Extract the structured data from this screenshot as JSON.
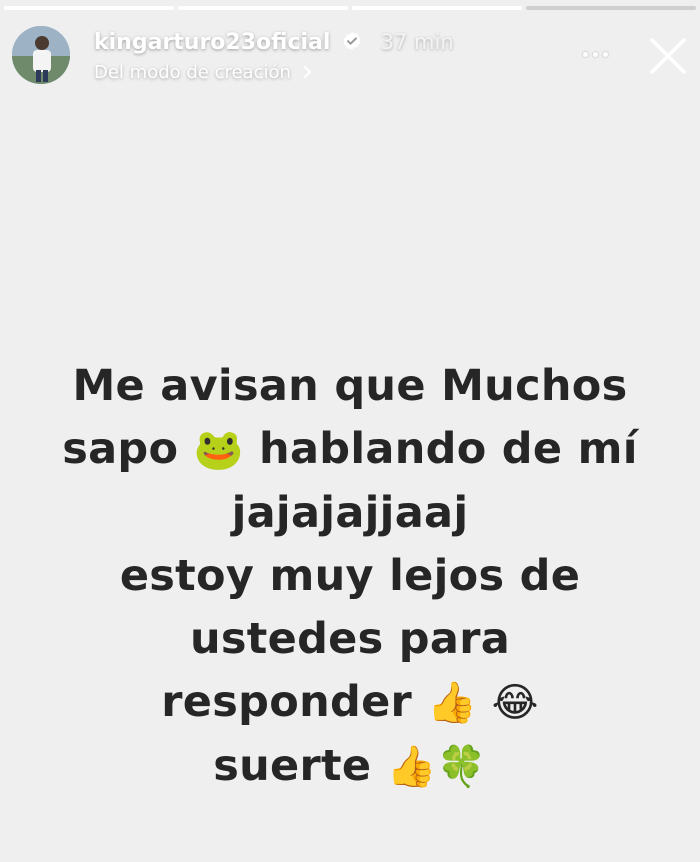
{
  "story": {
    "progress_segments": 4,
    "active_segment": 4
  },
  "header": {
    "username": "kingarturo23oficial",
    "verified": true,
    "time": "37 min",
    "subtitle": "Del modo de creación",
    "subtitle_icon": "chevron-right-icon",
    "more_icon": "more-horizontal-icon",
    "close_icon": "close-icon"
  },
  "message": {
    "line1": "Me avisan que Muchos",
    "line2_a": "sapo",
    "line2_emoji": "🐸",
    "line2_b": "hablando de mí",
    "line3": "jajajajjaaj",
    "line4": "estoy muy lejos de",
    "line5": "ustedes para",
    "line6_text": "responder",
    "line6_emoji": "👍 😂",
    "line7_text": "suerte",
    "line7_emoji": "👍🍀"
  },
  "colors": {
    "background": "#efefef",
    "text": "#262626",
    "verified_badge": "#ffffff"
  }
}
